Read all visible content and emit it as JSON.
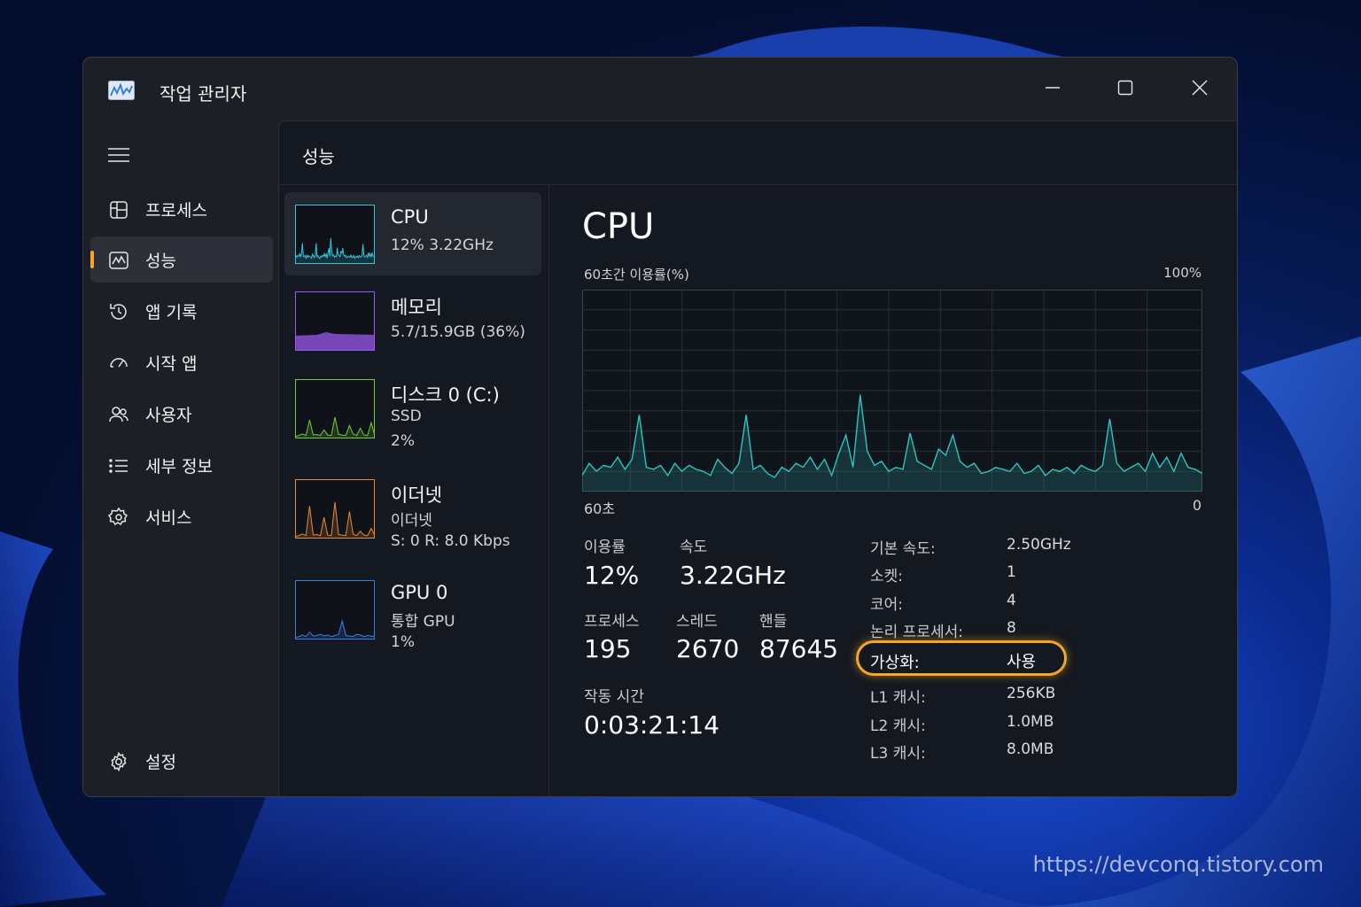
{
  "window": {
    "title": "작업 관리자"
  },
  "sidebar": {
    "items": [
      {
        "label": "프로세스",
        "icon": "processes-icon"
      },
      {
        "label": "성능",
        "icon": "performance-icon",
        "active": true
      },
      {
        "label": "앱 기록",
        "icon": "history-icon"
      },
      {
        "label": "시작 앱",
        "icon": "startup-icon"
      },
      {
        "label": "사용자",
        "icon": "users-icon"
      },
      {
        "label": "세부 정보",
        "icon": "details-icon"
      },
      {
        "label": "서비스",
        "icon": "services-icon"
      }
    ],
    "settings_label": "설정"
  },
  "content": {
    "title": "성능"
  },
  "devices": [
    {
      "name": "CPU",
      "line1": "12%  3.22GHz",
      "line2": "",
      "color": "#35c5d8"
    },
    {
      "name": "메모리",
      "line1": "5.7/15.9GB (36%)",
      "line2": "",
      "color": "#9b59f0"
    },
    {
      "name": "디스크 0 (C:)",
      "line1": "SSD",
      "line2": "2%",
      "color": "#6fcf3a"
    },
    {
      "name": "이더넷",
      "line1": "이더넷",
      "line2": "S: 0  R: 8.0 Kbps",
      "color": "#e8893a"
    },
    {
      "name": "GPU 0",
      "line1": "통합 GPU",
      "line2": "1%",
      "color": "#3c7ee0"
    }
  ],
  "detail": {
    "title": "CPU",
    "graph_top_left": "60초간 이용률(%)",
    "graph_top_right": "100%",
    "graph_bottom_left": "60초",
    "graph_bottom_right": "0",
    "graph_color": "#2ec4c0",
    "stats": {
      "utilization_label": "이용률",
      "utilization_value": "12%",
      "speed_label": "속도",
      "speed_value": "3.22GHz",
      "processes_label": "프로세스",
      "processes_value": "195",
      "threads_label": "스레드",
      "threads_value": "2670",
      "handles_label": "핸들",
      "handles_value": "87645",
      "uptime_label": "작동 시간",
      "uptime_value": "0:03:21:14"
    },
    "specs": [
      {
        "key": "기본 속도:",
        "value": "2.50GHz"
      },
      {
        "key": "소켓:",
        "value": "1"
      },
      {
        "key": "코어:",
        "value": "4"
      },
      {
        "key": "논리 프로세서:",
        "value": "8"
      },
      {
        "key": "가상화:",
        "value": "사용"
      },
      {
        "key": "L1 캐시:",
        "value": "256KB"
      },
      {
        "key": "L2 캐시:",
        "value": "1.0MB"
      },
      {
        "key": "L3 캐시:",
        "value": "8.0MB"
      }
    ],
    "cpu_history": [
      8,
      14,
      10,
      13,
      12,
      17,
      11,
      16,
      38,
      12,
      11,
      13,
      8,
      14,
      10,
      13,
      11,
      10,
      8,
      16,
      12,
      9,
      14,
      38,
      11,
      13,
      9,
      7,
      12,
      10,
      14,
      12,
      17,
      11,
      16,
      8,
      19,
      28,
      12,
      48,
      20,
      13,
      15,
      10,
      12,
      11,
      29,
      15,
      13,
      11,
      21,
      18,
      28,
      15,
      12,
      14,
      9,
      10,
      12,
      11,
      10,
      14,
      9,
      10,
      13,
      8,
      11,
      10,
      12,
      9,
      13,
      11,
      10,
      13,
      36,
      14,
      10,
      12,
      14,
      10,
      19,
      12,
      17,
      10,
      19,
      12,
      11,
      9
    ]
  },
  "watermark": "https://devconq.tistory.com"
}
